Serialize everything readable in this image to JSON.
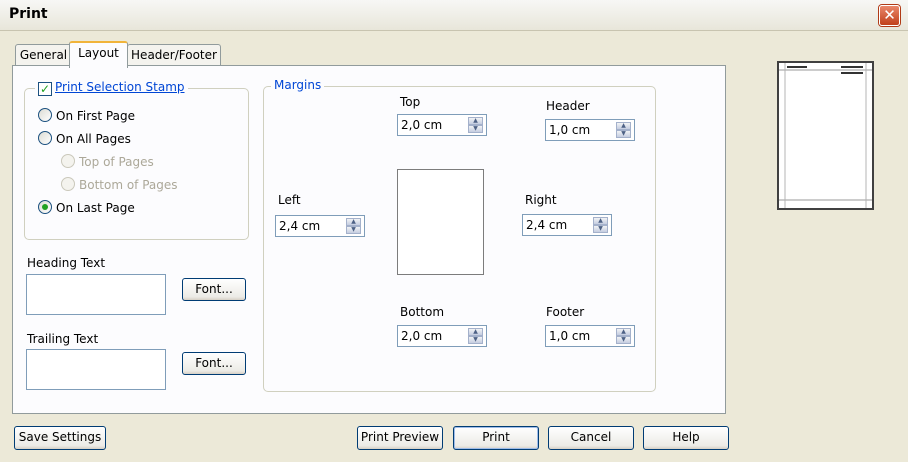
{
  "window": {
    "title": "Print",
    "close_glyph": "✕"
  },
  "tabs": [
    {
      "label": "General",
      "active": false
    },
    {
      "label": "Layout",
      "active": true
    },
    {
      "label": "Header/Footer",
      "active": false
    }
  ],
  "stamp": {
    "checkbox_label": "Print Selection Stamp",
    "checked": true,
    "check_glyph": "✓",
    "options": [
      {
        "label": "On First Page",
        "checked": false,
        "enabled": true
      },
      {
        "label": "On All Pages",
        "checked": false,
        "enabled": true
      },
      {
        "label": "Top of Pages",
        "checked": false,
        "enabled": false
      },
      {
        "label": "Bottom of Pages",
        "checked": false,
        "enabled": false
      },
      {
        "label": "On Last Page",
        "checked": true,
        "enabled": true
      }
    ]
  },
  "heading_text": {
    "label": "Heading Text",
    "value": "",
    "font_button": "Font..."
  },
  "trailing_text": {
    "label": "Trailing Text",
    "value": "",
    "font_button": "Font..."
  },
  "margins": {
    "legend": "Margins",
    "top": {
      "label": "Top",
      "value": "2,0 cm"
    },
    "header": {
      "label": "Header",
      "value": "1,0 cm"
    },
    "left": {
      "label": "Left",
      "value": "2,4 cm"
    },
    "right": {
      "label": "Right",
      "value": "2,4 cm"
    },
    "bottom": {
      "label": "Bottom",
      "value": "2,0 cm"
    },
    "footer": {
      "label": "Footer",
      "value": "1,0 cm"
    }
  },
  "spin_glyphs": {
    "up": "▲",
    "down": "▼"
  },
  "buttons": {
    "save_settings": "Save Settings",
    "print_preview": "Print Preview",
    "print": "Print",
    "cancel": "Cancel",
    "help": "Help"
  },
  "colors": {
    "legend_text": "#0046d5",
    "active_tab_accent": "#f1b43a",
    "window_bg": "#ece9d8",
    "close_button": "#c1401b"
  }
}
